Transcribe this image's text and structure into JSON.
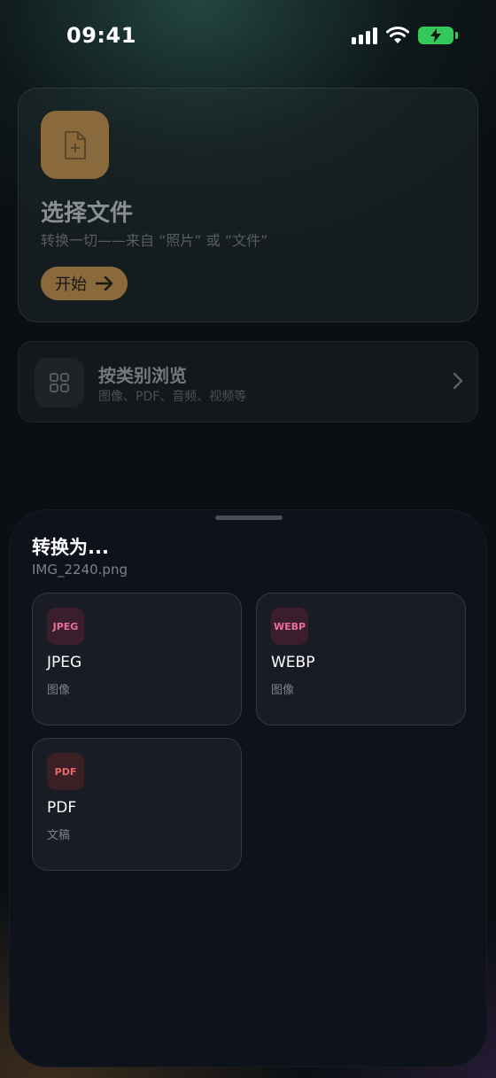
{
  "status_bar": {
    "time": "09:41",
    "icons": [
      "cellular-signal-icon",
      "wifi-icon",
      "battery-charging-icon"
    ],
    "battery_color": "#34c759"
  },
  "hero_card": {
    "icon": "file-plus-icon",
    "title": "选择文件",
    "subtitle": "转换一切——来自 “照片” 或 “文件”",
    "start_label": "开始",
    "start_icon": "arrow-right-icon",
    "accent": "#8a6a3c"
  },
  "browse_card": {
    "icon": "grid-icon",
    "title": "按类别浏览",
    "subtitle": "图像、PDF、音频、视频等",
    "chevron": "chevron-right-icon"
  },
  "sheet": {
    "title": "转换为...",
    "filename": "IMG_2240.png",
    "formats": [
      {
        "badge": "JPEG",
        "name": "JPEG",
        "category": "图像",
        "badge_color": "#e8709a"
      },
      {
        "badge": "WEBP",
        "name": "WEBP",
        "category": "图像",
        "badge_color": "#e8709a"
      },
      {
        "badge": "PDF",
        "name": "PDF",
        "category": "文稿",
        "badge_color": "#e86868"
      }
    ]
  }
}
